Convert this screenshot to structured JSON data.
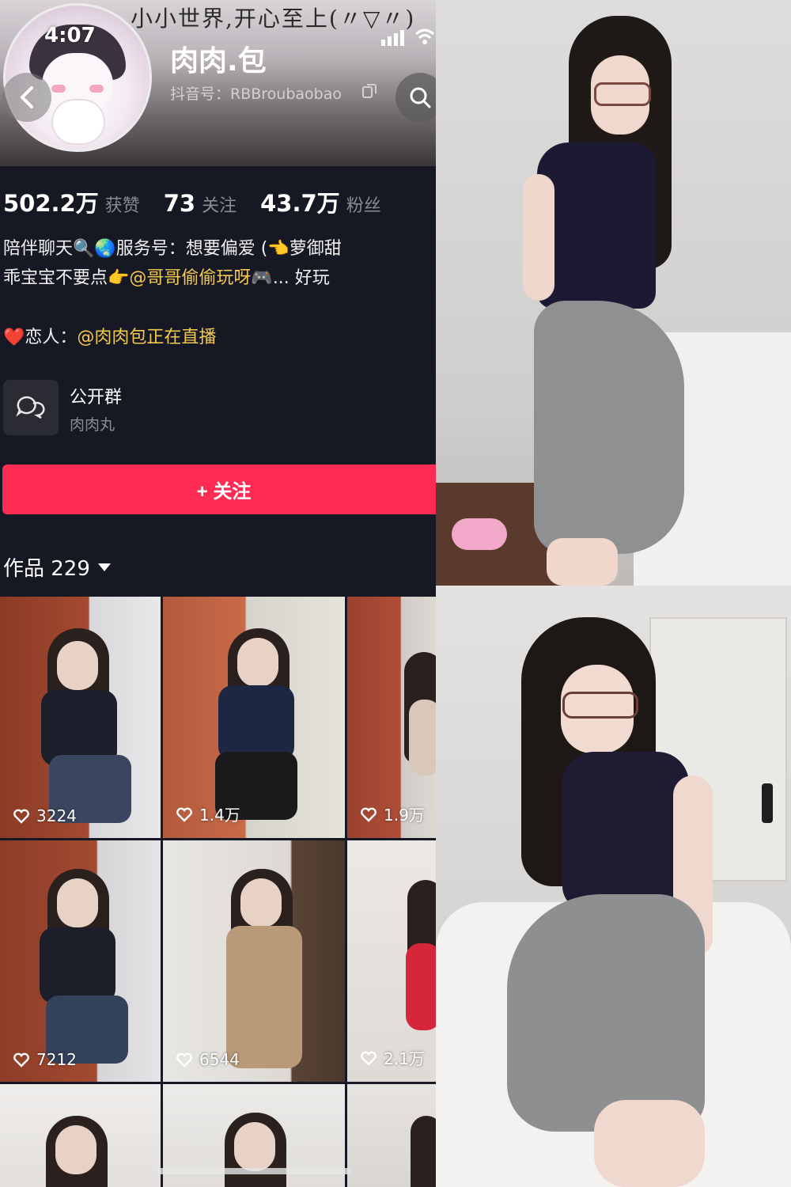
{
  "banner": {
    "text": "小小世界,开心至上(〃▽〃)"
  },
  "status_bar": {
    "time": "4:07"
  },
  "profile": {
    "name": "肉肉.包",
    "douyin_id": "抖音号：RBBroubaobao"
  },
  "stats": {
    "likes_value": "502.2万",
    "likes_label": "获赞",
    "following_value": "73",
    "following_label": "关注",
    "followers_value": "43.7万",
    "followers_label": "粉丝"
  },
  "bio": {
    "line1": "陪伴聊天🔍🌏服务号：想要偏爱 (👈萝御甜",
    "line2_prefix": "乖宝宝不要点👉",
    "line2_mention": "@哥哥偷偷玩呀🎮",
    "line2_suffix": "... 好玩",
    "lover_prefix": "❤️恋人：",
    "lover_mention": "@肉肉包正在直播"
  },
  "group": {
    "title": "公开群",
    "subtitle": "肉肉丸"
  },
  "follow_button": {
    "label": "+ 关注"
  },
  "works": {
    "label": "作品 229"
  },
  "videos": [
    {
      "likes": "3224"
    },
    {
      "likes": "1.4万"
    },
    {
      "likes": "1.9万"
    },
    {
      "likes": "7212"
    },
    {
      "likes": "6544"
    },
    {
      "likes": "2.1万"
    }
  ],
  "colors": {
    "accent": "#fe2c55",
    "mention": "#f3c94f",
    "background": "#161823"
  }
}
